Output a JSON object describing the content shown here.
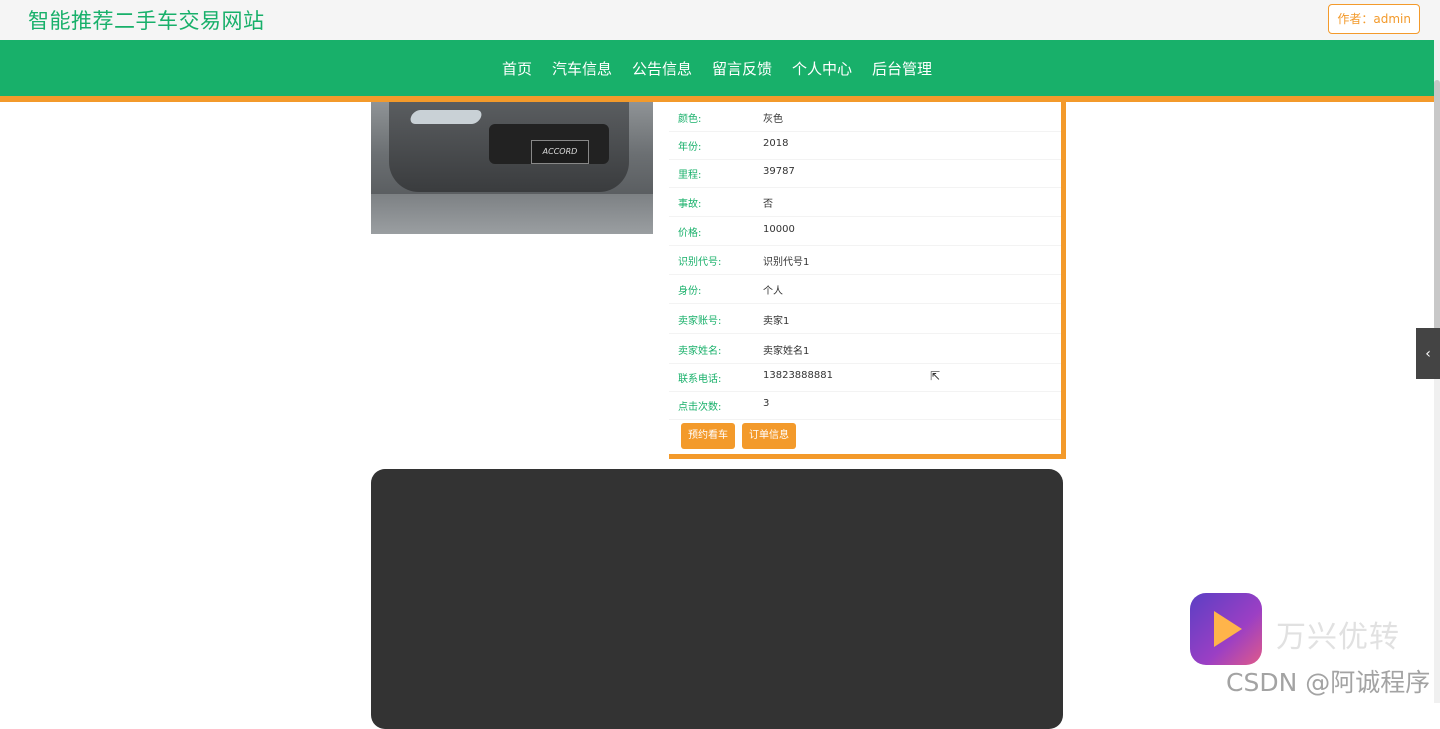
{
  "site": {
    "title": "智能推荐二手车交易网站",
    "author": "作者：admin"
  },
  "nav": [
    {
      "label": "首页"
    },
    {
      "label": "汽车信息"
    },
    {
      "label": "公告信息"
    },
    {
      "label": "留言反馈"
    },
    {
      "label": "个人中心"
    },
    {
      "label": "后台管理"
    }
  ],
  "car": {
    "plate_text": "ACCORD"
  },
  "details": [
    {
      "label": "颜色:",
      "value": "灰色"
    },
    {
      "label": "年份:",
      "value": "2018"
    },
    {
      "label": "里程:",
      "value": "39787"
    },
    {
      "label": "事故:",
      "value": "否"
    },
    {
      "label": "价格:",
      "value": "10000"
    },
    {
      "label": "识别代号:",
      "value": "识别代号1"
    },
    {
      "label": "身份:",
      "value": "个人"
    },
    {
      "label": "卖家账号:",
      "value": "卖家1"
    },
    {
      "label": "卖家姓名:",
      "value": "卖家姓名1"
    },
    {
      "label": "联系电话:",
      "value": "13823888881"
    },
    {
      "label": "点击次数:",
      "value": "3"
    }
  ],
  "buttons": {
    "book": "预约看车",
    "order": "订单信息"
  },
  "watermark": {
    "brand": "万兴优转",
    "csdn": "CSDN @阿诚程序"
  },
  "colors": {
    "primary": "#18b06a",
    "accent": "#f39a2b",
    "video_bg": "#333333"
  }
}
